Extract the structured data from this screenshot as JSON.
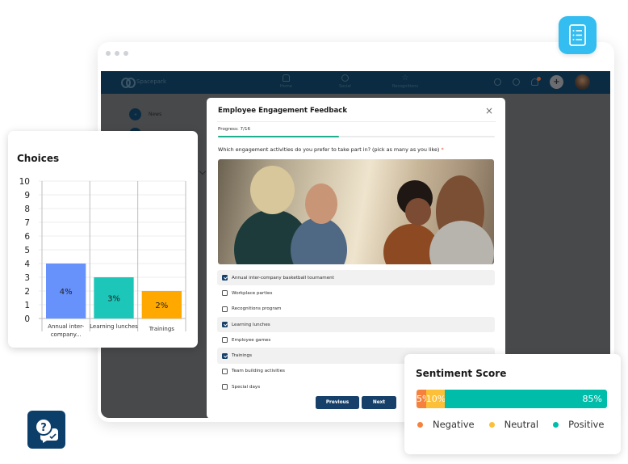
{
  "browser": {
    "app_name": "Spacepark",
    "nav": [
      {
        "label": "Home",
        "icon": "home-icon"
      },
      {
        "label": "Social",
        "icon": "social-icon"
      },
      {
        "label": "Recognitions",
        "icon": "star-icon"
      }
    ],
    "right_icons": [
      "chat-icon",
      "search-icon",
      "bell-icon",
      "plus-icon",
      "avatar"
    ],
    "plus_label": "+",
    "sidebar": [
      {
        "label": "News",
        "icon": "megaphone-icon"
      }
    ]
  },
  "modal": {
    "title": "Employee Engagement Feedback",
    "close_label": "×",
    "progress_label": "Progress: 7/16",
    "progress": {
      "current": 7,
      "total": 16
    },
    "question": "Which engagement activities do you prefer to take part in? (pick as many as you like)",
    "required_mark": "*",
    "options": [
      {
        "label": "Annual inter-company basketball tournament",
        "checked": true
      },
      {
        "label": "Workplace parties",
        "checked": false
      },
      {
        "label": "Recognitions program",
        "checked": false
      },
      {
        "label": "Learning lunches",
        "checked": true
      },
      {
        "label": "Employee games",
        "checked": false
      },
      {
        "label": "Trainings",
        "checked": true
      },
      {
        "label": "Team building activities",
        "checked": false
      },
      {
        "label": "Special days",
        "checked": false
      }
    ],
    "previous_label": "Previous",
    "next_label": "Next"
  },
  "choices_card": {
    "title": "Choices"
  },
  "chart_data": {
    "type": "bar",
    "title": "Choices",
    "categories": [
      "Annual inter-company...",
      "Learning lunches",
      "Trainings"
    ],
    "category_lines": [
      [
        "Annual inter-",
        "company..."
      ],
      [
        "Learning lunches"
      ],
      [
        "Trainings"
      ]
    ],
    "values": [
      4,
      3,
      2
    ],
    "data_labels": [
      "4%",
      "3%",
      "2%"
    ],
    "colors": [
      "#6791fb",
      "#1cc7b9",
      "#ffa800"
    ],
    "yticks": [
      "0",
      "1",
      "2",
      "3",
      "4",
      "5",
      "6",
      "7",
      "8",
      "9",
      "10"
    ],
    "ylim": [
      0,
      10
    ],
    "grid": true,
    "xlabel": "",
    "ylabel": ""
  },
  "sentiment": {
    "title": "Sentiment Score",
    "segments": [
      {
        "label": "Negative",
        "value": 5,
        "text": "5%",
        "color": "#f5813c"
      },
      {
        "label": "Neutral",
        "value": 10,
        "text": "10%",
        "color": "#fbbf38"
      },
      {
        "label": "Positive",
        "value": 85,
        "text": "85%",
        "color": "#00bdaa"
      }
    ]
  },
  "colors": {
    "navbar": "#0a2b42",
    "primary_button": "#16406a",
    "progress": "#1fae8e",
    "doc_badge": "#33bdf0",
    "qa_badge": "#0c3e6a"
  }
}
